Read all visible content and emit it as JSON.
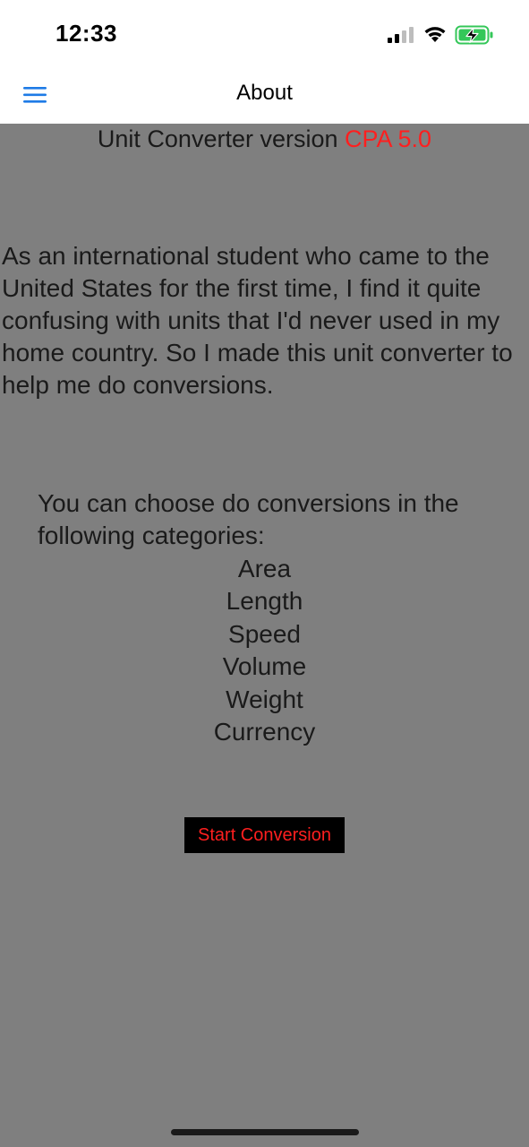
{
  "status_bar": {
    "time": "12:33",
    "icons": [
      "signal-icon",
      "wifi-icon",
      "battery-charging-icon"
    ]
  },
  "nav": {
    "title": "About",
    "menu_icon": "hamburger-menu-icon"
  },
  "content": {
    "version_prefix": "Unit Converter version ",
    "version_number": "CPA 5.0",
    "intro": "As an international student who came to the United States for the first time, I find it quite confusing with units that I'd never used in my home country. So I made this unit converter to help me do conversions.",
    "categories_intro": "You can choose do conversions in the following categories:",
    "categories": [
      "Area",
      "Length",
      "Speed",
      "Volume",
      "Weight",
      "Currency"
    ],
    "start_button_label": "Start Conversion"
  },
  "colors": {
    "background": "#7f7f7f",
    "accent_red": "#ff1f1f",
    "menu_blue": "#1e7be6",
    "battery_green": "#34c759"
  }
}
